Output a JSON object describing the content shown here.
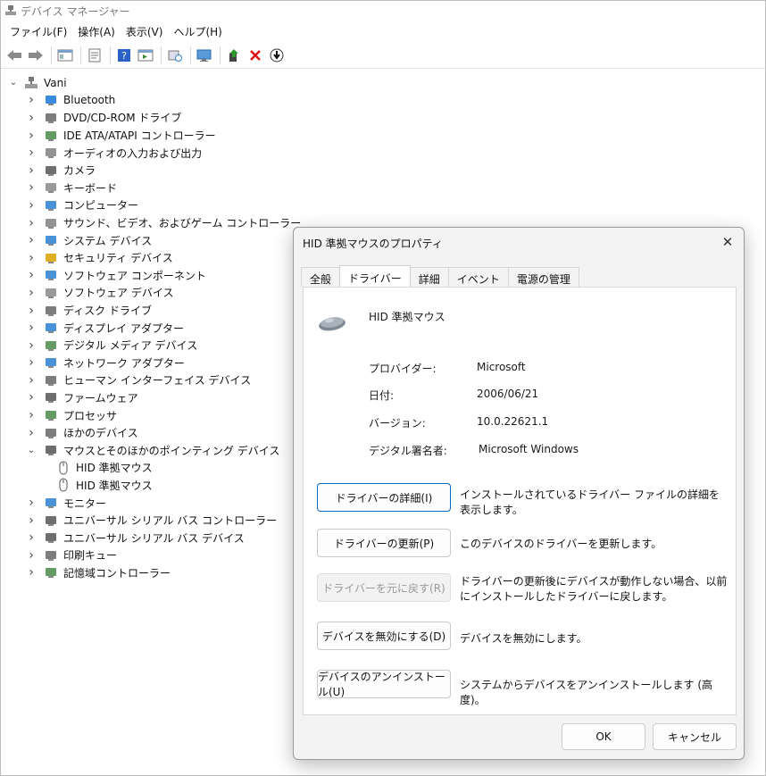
{
  "window": {
    "title": "デバイス マネージャー"
  },
  "menu": [
    "ファイル(F)",
    "操作(A)",
    "表示(V)",
    "ヘルプ(H)"
  ],
  "tree": {
    "root": "Vani",
    "items": [
      {
        "label": "Bluetooth",
        "icon": "bluetooth-icon",
        "color": "#1877d8"
      },
      {
        "label": "DVD/CD-ROM ドライブ",
        "icon": "dvd-drive-icon",
        "color": "#666666"
      },
      {
        "label": "IDE ATA/ATAPI コントローラー",
        "icon": "ide-controller-icon",
        "color": "#4a8a4a"
      },
      {
        "label": "オーディオの入力および出力",
        "icon": "speaker-icon",
        "color": "#808080"
      },
      {
        "label": "カメラ",
        "icon": "camera-icon",
        "color": "#555555"
      },
      {
        "label": "キーボード",
        "icon": "keyboard-icon",
        "color": "#888888"
      },
      {
        "label": "コンピューター",
        "icon": "computer-icon",
        "color": "#2a7fd0"
      },
      {
        "label": "サウンド、ビデオ、およびゲーム コントローラー",
        "icon": "sound-icon",
        "color": "#808080"
      },
      {
        "label": "システム デバイス",
        "icon": "system-device-icon",
        "color": "#2a7fd0"
      },
      {
        "label": "セキュリティ デバイス",
        "icon": "security-key-icon",
        "color": "#d8a000"
      },
      {
        "label": "ソフトウェア コンポーネント",
        "icon": "software-component-icon",
        "color": "#2a7fd0"
      },
      {
        "label": "ソフトウェア デバイス",
        "icon": "software-device-icon",
        "color": "#888888"
      },
      {
        "label": "ディスク ドライブ",
        "icon": "disk-drive-icon",
        "color": "#666666"
      },
      {
        "label": "ディスプレイ アダプター",
        "icon": "display-adapter-icon",
        "color": "#2a7fd0"
      },
      {
        "label": "デジタル メディア デバイス",
        "icon": "digital-media-icon",
        "color": "#4a8a4a"
      },
      {
        "label": "ネットワーク アダプター",
        "icon": "network-adapter-icon",
        "color": "#2a7fd0"
      },
      {
        "label": "ヒューマン インターフェイス デバイス",
        "icon": "hid-icon",
        "color": "#666666"
      },
      {
        "label": "ファームウェア",
        "icon": "firmware-icon",
        "color": "#555555"
      },
      {
        "label": "プロセッサ",
        "icon": "processor-icon",
        "color": "#4a8a4a"
      },
      {
        "label": "ほかのデバイス",
        "icon": "other-device-icon",
        "color": "#666666"
      },
      {
        "label": "マウスとそのほかのポインティング デバイス",
        "icon": "mouse-icon",
        "color": "#555555",
        "expanded": true,
        "children": [
          "HID 準拠マウス",
          "HID 準拠マウス"
        ]
      },
      {
        "label": "モニター",
        "icon": "monitor-icon",
        "color": "#2a7fd0"
      },
      {
        "label": "ユニバーサル シリアル バス コントローラー",
        "icon": "usb-icon",
        "color": "#555555"
      },
      {
        "label": "ユニバーサル シリアル バス デバイス",
        "icon": "usb-icon",
        "color": "#555555"
      },
      {
        "label": "印刷キュー",
        "icon": "printer-icon",
        "color": "#666666"
      },
      {
        "label": "記憶域コントローラー",
        "icon": "storage-controller-icon",
        "color": "#4a8a4a"
      }
    ]
  },
  "dialog": {
    "title": "HID 準拠マウスのプロパティ",
    "tabs": [
      "全般",
      "ドライバー",
      "詳細",
      "イベント",
      "電源の管理"
    ],
    "active_tab": 1,
    "device_name": "HID 準拠マウス",
    "props": [
      {
        "label": "プロバイダー:",
        "value": "Microsoft"
      },
      {
        "label": "日付:",
        "value": "2006/06/21"
      },
      {
        "label": "バージョン:",
        "value": "10.0.22621.1"
      },
      {
        "label": "デジタル署名者:",
        "value": "Microsoft Windows"
      }
    ],
    "actions": [
      {
        "button": "ドライバーの詳細(I)",
        "desc": "インストールされているドライバー ファイルの詳細を表示します。",
        "state": "focused"
      },
      {
        "button": "ドライバーの更新(P)",
        "desc": "このデバイスのドライバーを更新します。",
        "state": "normal"
      },
      {
        "button": "ドライバーを元に戻す(R)",
        "desc": "ドライバーの更新後にデバイスが動作しない場合、以前にインストールしたドライバーに戻します。",
        "state": "disabled"
      },
      {
        "button": "デバイスを無効にする(D)",
        "desc": "デバイスを無効にします。",
        "state": "normal"
      },
      {
        "button": "デバイスのアンインストール(U)",
        "desc": "システムからデバイスをアンインストールします (高度)。",
        "state": "normal"
      }
    ],
    "ok": "OK",
    "cancel": "キャンセル"
  }
}
